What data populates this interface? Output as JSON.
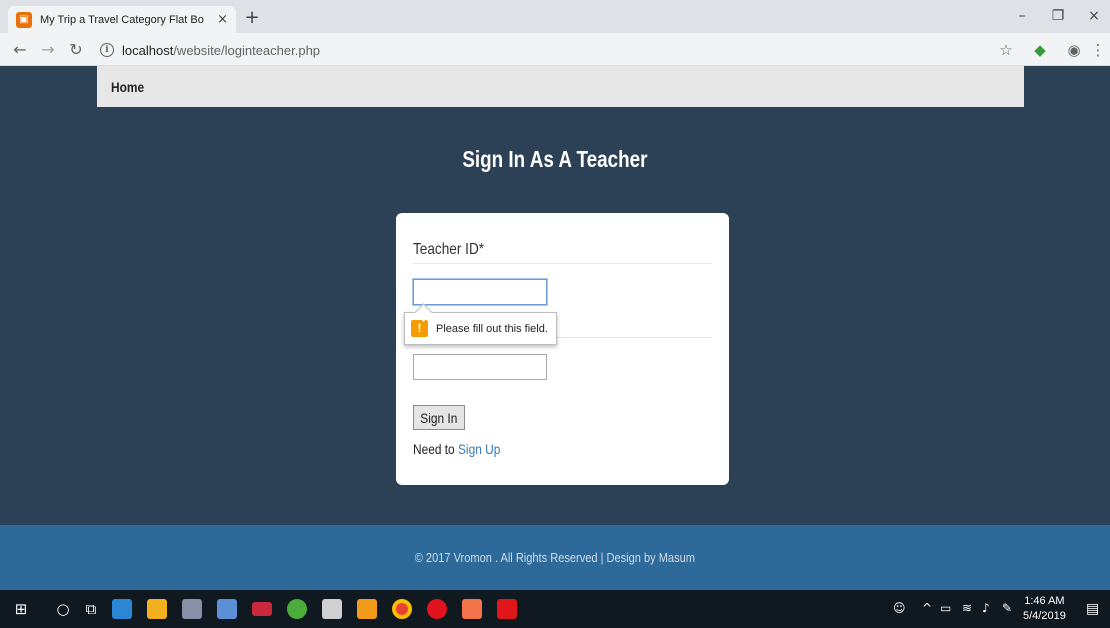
{
  "browser": {
    "tab_title": "My Trip a Travel Category Flat Bo",
    "tab_close": "×",
    "new_tab": "+",
    "url_host": "localhost",
    "url_path": "/website/loginteacher.php",
    "window_controls": {
      "minimize": "–",
      "restore": "❐",
      "close": "×"
    },
    "icons": [
      "back-icon",
      "forward-icon",
      "reload-icon",
      "info-icon",
      "star-icon",
      "extension-icon",
      "profile-icon",
      "menu-icon"
    ]
  },
  "navbar": {
    "home": "Home"
  },
  "login": {
    "title": "Sign In As A Teacher",
    "teacher_id_label": "Teacher ID*",
    "teacher_id_value": "",
    "password_value": "",
    "validation_message": "Please fill out this field.",
    "warning_glyph": "!",
    "signin_label": "Sign In",
    "need_text": "Need to",
    "signup_link": "Sign Up"
  },
  "footer": {
    "text": "© 2017 Vromon . All Rights Reserved | Design by Masum"
  },
  "taskbar": {
    "time": "1:46 AM",
    "date": "5/4/2019",
    "colors": {
      "page_bg": "#2d4156",
      "footer_bg": "#2d6a9a",
      "link": "#337ab7",
      "warning": "#f59c00"
    }
  }
}
